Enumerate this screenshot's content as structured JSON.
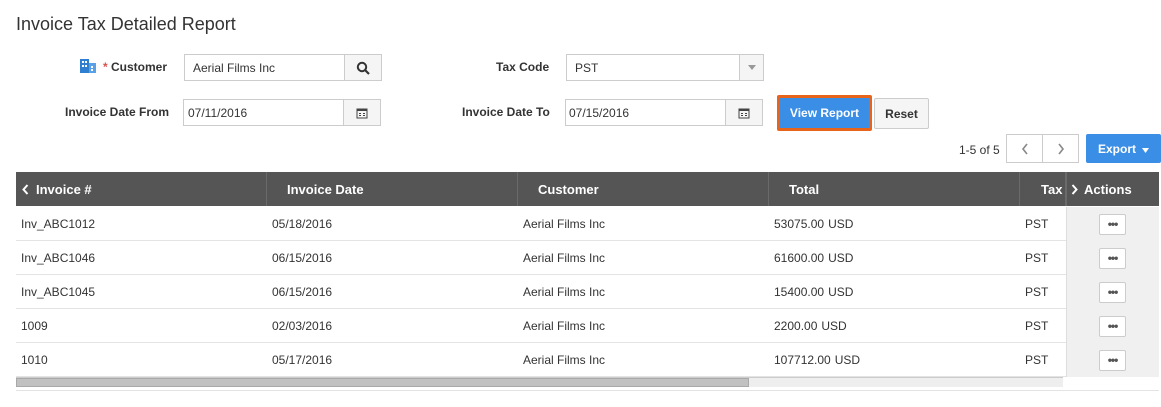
{
  "page": {
    "title": "Invoice Tax Detailed Report"
  },
  "filters": {
    "customer": {
      "label": "Customer",
      "required_mark": "*",
      "value": "Aerial Films Inc",
      "icon": "building-icon",
      "search_icon": "search-icon"
    },
    "tax_code": {
      "label": "Tax Code",
      "value": "PST"
    },
    "invoice_date_from": {
      "label": "Invoice Date From",
      "value": "07/11/2016"
    },
    "invoice_date_to": {
      "label": "Invoice Date To",
      "value": "07/15/2016"
    }
  },
  "buttons": {
    "view_report": "View Report",
    "reset": "Reset",
    "export": "Export"
  },
  "pagination": {
    "text": "1-5 of 5",
    "start": 1,
    "end": 5,
    "total": 5
  },
  "colors": {
    "accent": "#3a8ee6",
    "highlight": "#e8641b",
    "header_bg": "#555555",
    "required": "#d9534f"
  },
  "table": {
    "columns": [
      "Invoice #",
      "Invoice Date",
      "Customer",
      "Total",
      "Tax",
      "Actions"
    ],
    "rows": [
      {
        "invoice": "Inv_ABC1012",
        "date": "05/18/2016",
        "customer": "Aerial Films Inc",
        "total": "53075.00",
        "currency": "USD",
        "tax": "PST"
      },
      {
        "invoice": "Inv_ABC1046",
        "date": "06/15/2016",
        "customer": "Aerial Films Inc",
        "total": "61600.00",
        "currency": "USD",
        "tax": "PST"
      },
      {
        "invoice": "Inv_ABC1045",
        "date": "06/15/2016",
        "customer": "Aerial Films Inc",
        "total": "15400.00",
        "currency": "USD",
        "tax": "PST"
      },
      {
        "invoice": "1009",
        "date": "02/03/2016",
        "customer": "Aerial Films Inc",
        "total": "2200.00",
        "currency": "USD",
        "tax": "PST"
      },
      {
        "invoice": "1010",
        "date": "05/17/2016",
        "customer": "Aerial Films Inc",
        "total": "107712.00",
        "currency": "USD",
        "tax": "PST"
      }
    ],
    "horizontal_scroll_fraction": 0.7
  }
}
